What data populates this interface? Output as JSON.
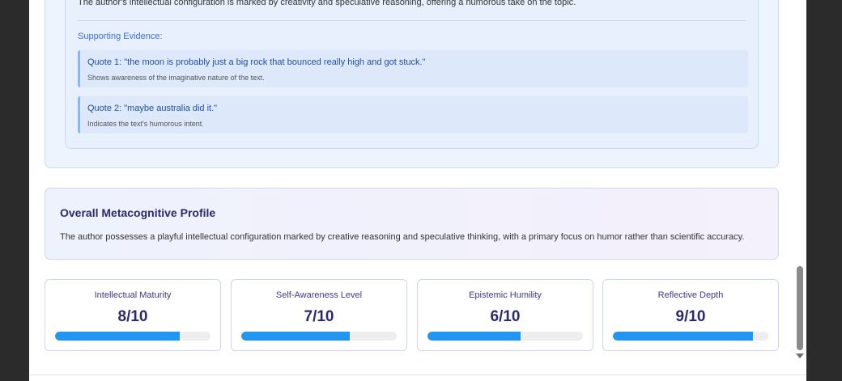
{
  "analysis": {
    "configuration_text": "The author's intellectual configuration is marked by creativity and speculative reasoning, offering a humorous take on the topic.",
    "evidence_heading": "Supporting Evidence:",
    "quotes": [
      {
        "title": "Quote 1: \"the moon is probably just a big rock that bounced really high and got stuck.\"",
        "note": "Shows awareness of the imaginative nature of the text."
      },
      {
        "title": "Quote 2: \"maybe australia did it.\"",
        "note": "Indicates the text's humorous intent."
      }
    ]
  },
  "profile": {
    "title": "Overall Metacognitive Profile",
    "description": "The author possesses a playful intellectual configuration marked by creative reasoning and speculative thinking, with a primary focus on humor rather than scientific accuracy."
  },
  "metrics": [
    {
      "label": "Intellectual Maturity",
      "value": "8/10",
      "score": 8,
      "max": 10
    },
    {
      "label": "Self-Awareness Level",
      "value": "7/10",
      "score": 7,
      "max": 10
    },
    {
      "label": "Epistemic Humility",
      "value": "6/10",
      "score": 6,
      "max": 10
    },
    {
      "label": "Reflective Depth",
      "value": "9/10",
      "score": 9,
      "max": 10
    }
  ],
  "colors": {
    "accent": "#2196f3",
    "heading": "#2c2a6b",
    "evidence_blue": "#3b6fd0"
  }
}
